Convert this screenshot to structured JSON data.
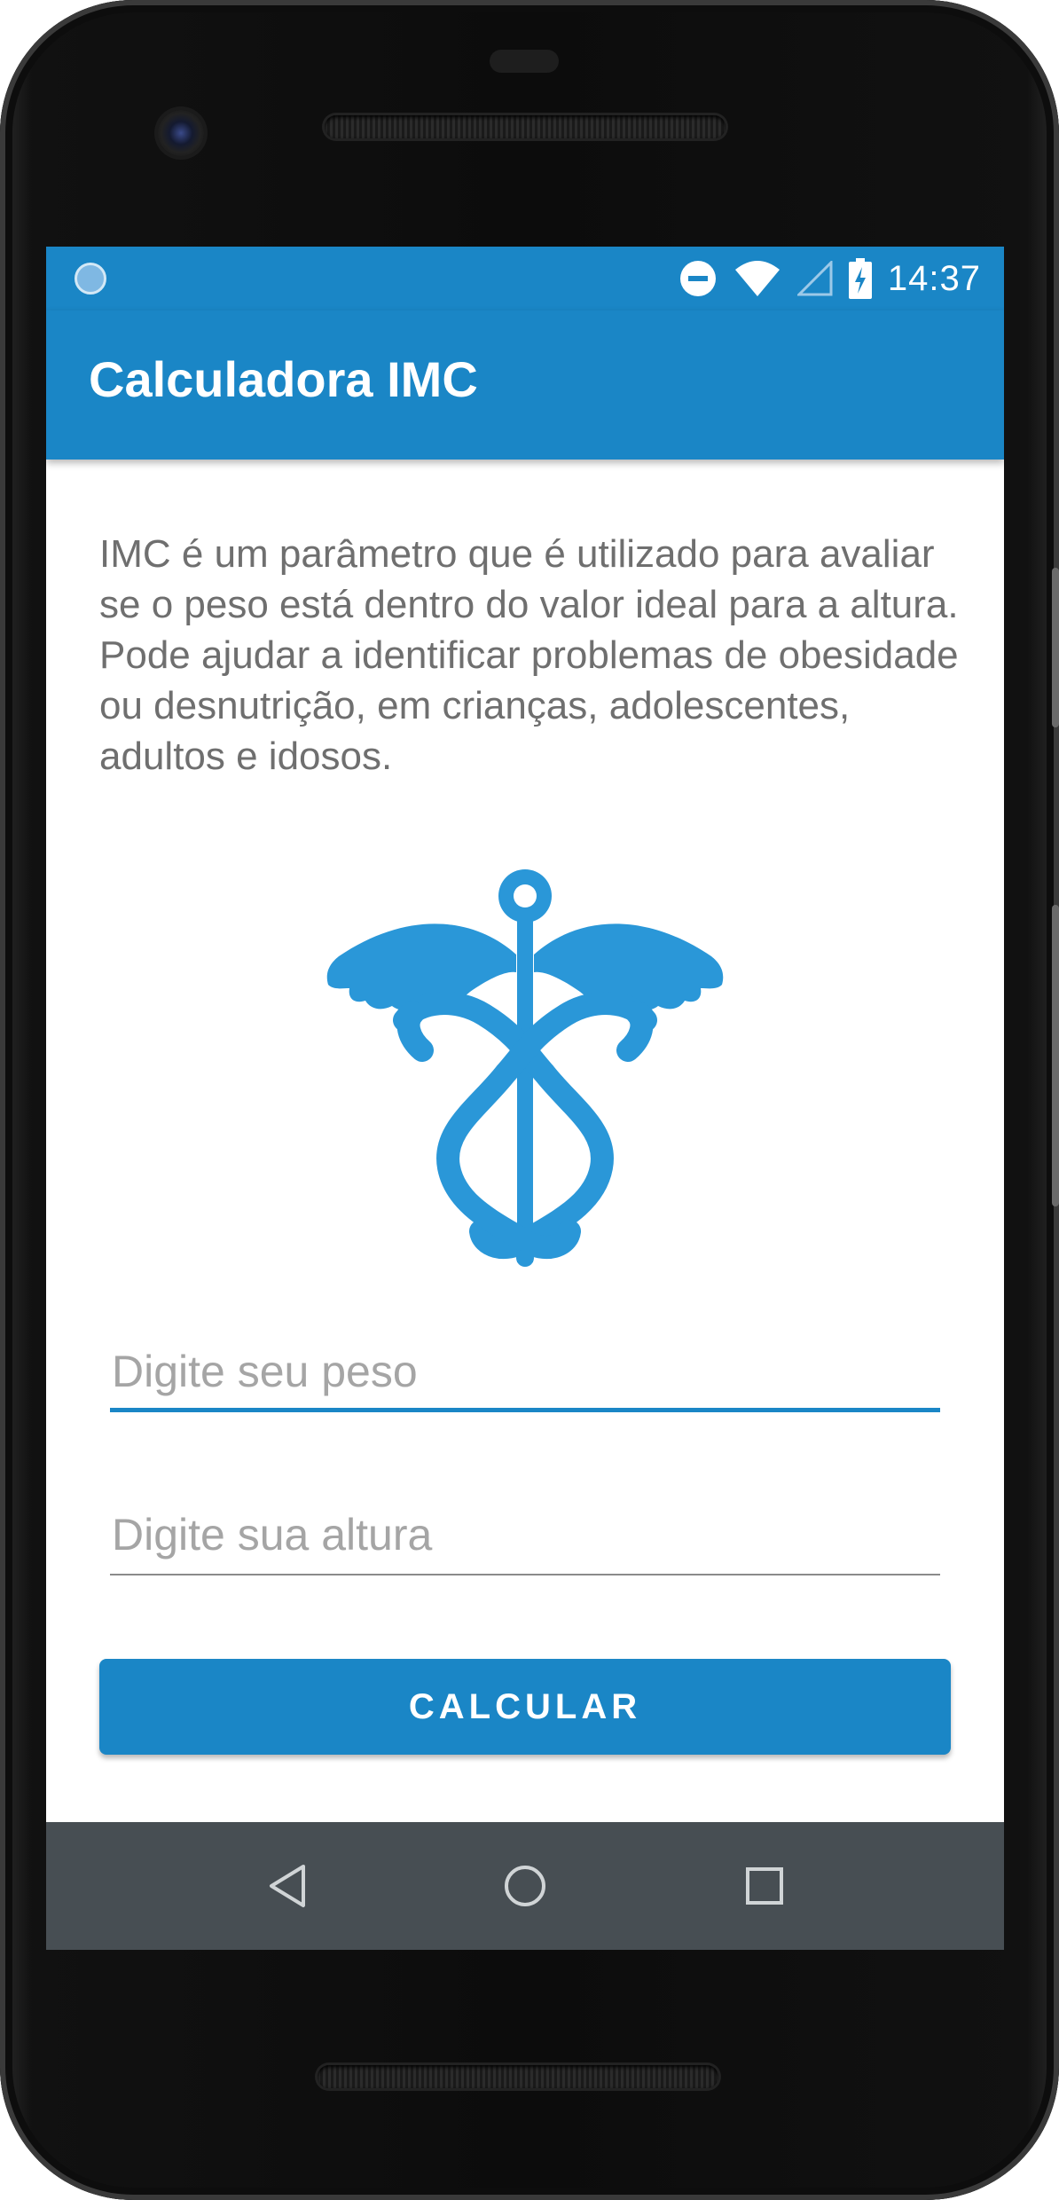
{
  "colors": {
    "primary": "#1a86c6",
    "nav_bar": "#474e53",
    "description_text": "#6f6f6f",
    "hint_text": "#a5a5a5",
    "logo": "#2a97d8"
  },
  "status_bar": {
    "time": "14:37",
    "icons": [
      "loading-icon",
      "do-not-disturb-icon",
      "wifi-icon",
      "cell-signal-icon",
      "battery-charging-icon"
    ]
  },
  "app_bar": {
    "title": "Calculadora IMC"
  },
  "main": {
    "description": "IMC é um parâmetro que é utilizado para avaliar se o peso está dentro do valor ideal para a altura. Pode ajudar a identificar problemas de obesidade ou desnutrição, em crianças, adolescentes, adultos e idosos.",
    "logo_icon": "caduceus-icon",
    "weight_input": {
      "value": "",
      "placeholder": "Digite seu peso",
      "focused": true
    },
    "height_input": {
      "value": "",
      "placeholder": "Digite sua altura",
      "focused": false
    },
    "calculate_button": {
      "label": "CALCULAR"
    }
  },
  "nav_bar": {
    "buttons": [
      "back-icon",
      "home-icon",
      "recents-icon"
    ]
  }
}
